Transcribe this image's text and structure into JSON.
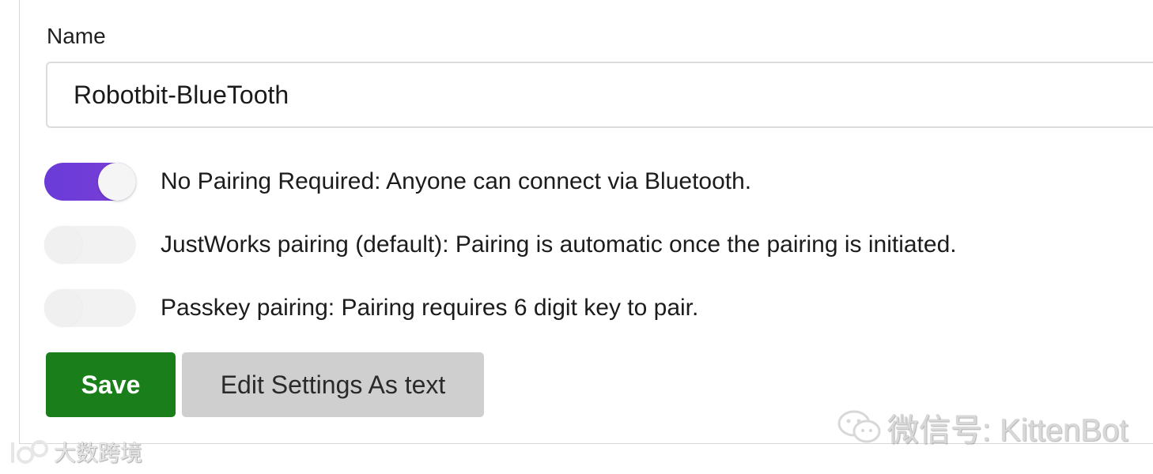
{
  "form": {
    "name_label": "Name",
    "name_value": "Robotbit-BlueTooth"
  },
  "pairing_options": [
    {
      "label": "No Pairing Required: Anyone can connect via Bluetooth.",
      "enabled": true
    },
    {
      "label": "JustWorks pairing (default): Pairing is automatic once the pairing is initiated.",
      "enabled": false
    },
    {
      "label": "Passkey pairing: Pairing requires 6 digit key to pair.",
      "enabled": false
    }
  ],
  "buttons": {
    "save_label": "Save",
    "edit_label": "Edit Settings As text"
  },
  "watermarks": {
    "wechat": "微信号: KittenBot",
    "corner": "大数跨境",
    "wechat_icon": "wechat-logo-icon",
    "corner_icon": "brand-logo-icon"
  },
  "colors": {
    "toggle_on": "#6a3bd8",
    "toggle_off": "#f2f2f2",
    "save_button": "#1a7f1a",
    "edit_button": "#cfcfcf"
  }
}
